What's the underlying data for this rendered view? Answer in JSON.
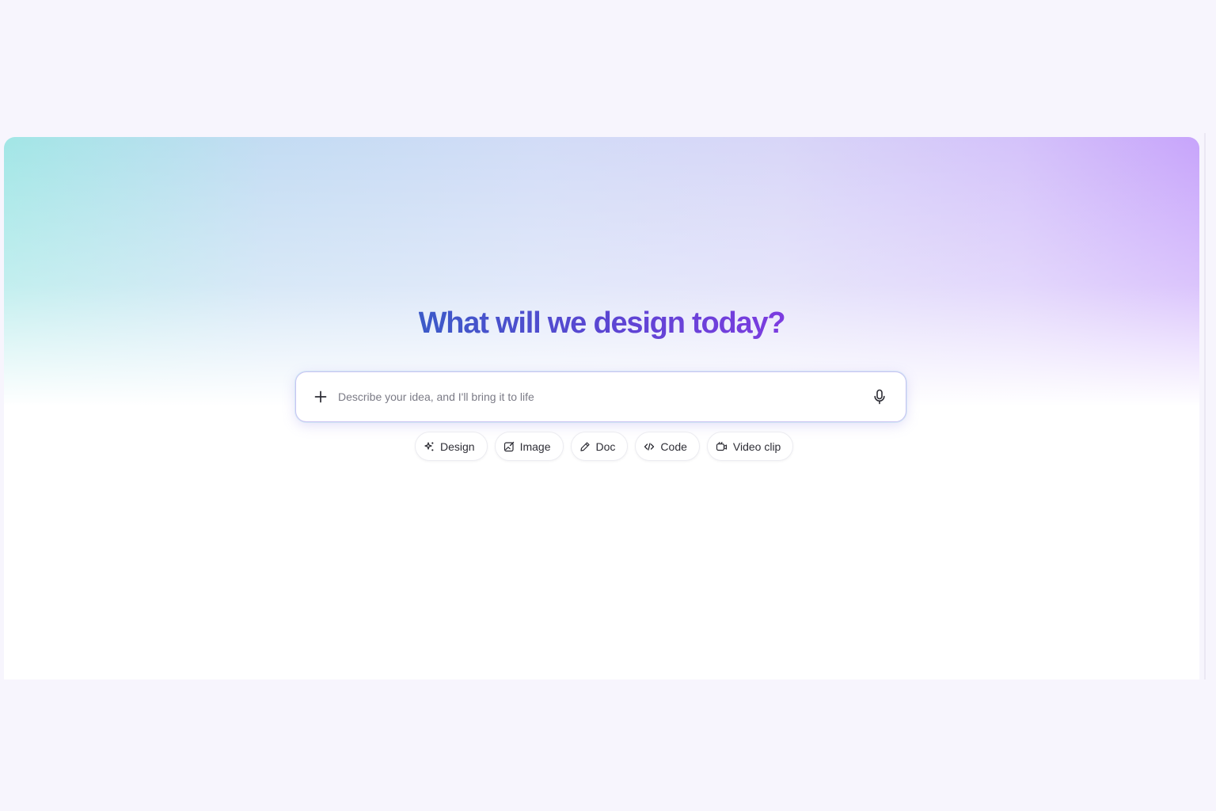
{
  "hero": {
    "headline": "What will we design today?"
  },
  "prompt": {
    "placeholder": "Describe your idea, and I'll bring it to life",
    "add_icon": "plus-icon",
    "mic_icon": "microphone-icon"
  },
  "chips": [
    {
      "label": "Design",
      "icon": "sparkle-icon"
    },
    {
      "label": "Image",
      "icon": "image-edit-icon"
    },
    {
      "label": "Doc",
      "icon": "pen-icon"
    },
    {
      "label": "Code",
      "icon": "code-icon"
    },
    {
      "label": "Video clip",
      "icon": "video-camera-icon"
    }
  ],
  "colors": {
    "page_bg": "#f7f5fd",
    "headline_start": "#3c5ac8",
    "headline_end": "#7c3ce0",
    "input_border": "#c9c3f2",
    "gradient_left": "#a2e6e6",
    "gradient_right": "#c7a4fb"
  }
}
